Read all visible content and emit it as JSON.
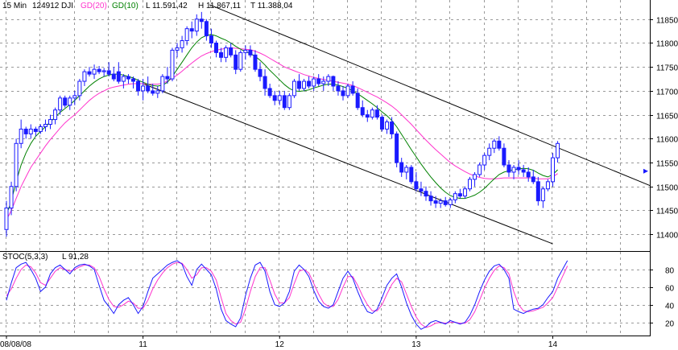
{
  "header": {
    "timeframe": "15 Min",
    "symbol_id": "124912",
    "symbol": "DJI",
    "ma_slow_label": "GD(20)",
    "ma_fast_label": "GD(10)",
    "low_label": "L 11.591,42",
    "high_label": "H 11.867,11",
    "close_label": "T 11.388,04"
  },
  "stoch_header": {
    "indicator_label": "STOC(5,3,3)",
    "last_label": "L 91,28"
  },
  "colors": {
    "up_candle": "#ffffff",
    "down_candle": "#1a1aff",
    "candle_outline": "#1a1aff",
    "ma_slow": "#ff33cc",
    "ma_fast": "#008000",
    "stoch_k": "#1a1aff",
    "stoch_d": "#ff33cc",
    "channel": "#000000",
    "grid": "#9a9a9a",
    "marker": "#1a1aff"
  },
  "chart_data": [
    {
      "type": "candlestick",
      "title": "",
      "y_ticks": [
        11400,
        11450,
        11500,
        11550,
        11600,
        11650,
        11700,
        11750,
        11800,
        11850
      ],
      "ylim": [
        11365,
        11890
      ],
      "x_tick_labels": [
        {
          "bar": 0,
          "label": "08/08/08"
        },
        {
          "bar": 28,
          "label": "11"
        },
        {
          "bar": 56,
          "label": "12"
        },
        {
          "bar": 84,
          "label": "13"
        },
        {
          "bar": 112,
          "label": "14"
        }
      ],
      "grid": true,
      "ohlc": [
        [
          11410,
          11470,
          11395,
          11455
        ],
        [
          11455,
          11510,
          11440,
          11500
        ],
        [
          11500,
          11600,
          11490,
          11590
        ],
        [
          11590,
          11640,
          11580,
          11620
        ],
        [
          11620,
          11625,
          11600,
          11610
        ],
        [
          11610,
          11630,
          11600,
          11620
        ],
        [
          11620,
          11625,
          11605,
          11615
        ],
        [
          11615,
          11630,
          11610,
          11625
        ],
        [
          11625,
          11640,
          11615,
          11630
        ],
        [
          11630,
          11650,
          11620,
          11640
        ],
        [
          11640,
          11665,
          11630,
          11660
        ],
        [
          11660,
          11690,
          11650,
          11685
        ],
        [
          11685,
          11690,
          11665,
          11670
        ],
        [
          11670,
          11690,
          11660,
          11685
        ],
        [
          11685,
          11700,
          11670,
          11690
        ],
        [
          11690,
          11725,
          11680,
          11720
        ],
        [
          11720,
          11745,
          11710,
          11740
        ],
        [
          11740,
          11750,
          11730,
          11735
        ],
        [
          11735,
          11755,
          11725,
          11745
        ],
        [
          11745,
          11752,
          11735,
          11740
        ],
        [
          11740,
          11748,
          11730,
          11742
        ],
        [
          11742,
          11760,
          11730,
          11735
        ],
        [
          11735,
          11750,
          11720,
          11725
        ],
        [
          11740,
          11760,
          11715,
          11720
        ],
        [
          11720,
          11735,
          11705,
          11730
        ],
        [
          11730,
          11735,
          11715,
          11725
        ],
        [
          11725,
          11730,
          11705,
          11720
        ],
        [
          11720,
          11725,
          11690,
          11700
        ],
        [
          11700,
          11725,
          11680,
          11710
        ],
        [
          11710,
          11730,
          11695,
          11700
        ],
        [
          11700,
          11715,
          11690,
          11695
        ],
        [
          11695,
          11710,
          11685,
          11700
        ],
        [
          11700,
          11735,
          11695,
          11730
        ],
        [
          11730,
          11750,
          11715,
          11725
        ],
        [
          11725,
          11790,
          11720,
          11785
        ],
        [
          11785,
          11800,
          11770,
          11790
        ],
        [
          11790,
          11815,
          11780,
          11805
        ],
        [
          11805,
          11835,
          11795,
          11830
        ],
        [
          11830,
          11845,
          11810,
          11825
        ],
        [
          11825,
          11860,
          11815,
          11850
        ],
        [
          11850,
          11865,
          11830,
          11845
        ],
        [
          11845,
          11850,
          11805,
          11815
        ],
        [
          11815,
          11830,
          11790,
          11800
        ],
        [
          11800,
          11805,
          11770,
          11780
        ],
        [
          11780,
          11790,
          11760,
          11770
        ],
        [
          11770,
          11795,
          11760,
          11790
        ],
        [
          11790,
          11800,
          11770,
          11775
        ],
        [
          11775,
          11785,
          11735,
          11745
        ],
        [
          11745,
          11785,
          11740,
          11780
        ],
        [
          11780,
          11795,
          11765,
          11785
        ],
        [
          11785,
          11795,
          11770,
          11775
        ],
        [
          11775,
          11785,
          11740,
          11745
        ],
        [
          11745,
          11760,
          11720,
          11730
        ],
        [
          11730,
          11745,
          11690,
          11705
        ],
        [
          11705,
          11715,
          11685,
          11690
        ],
        [
          11690,
          11700,
          11670,
          11680
        ],
        [
          11680,
          11700,
          11670,
          11690
        ],
        [
          11690,
          11700,
          11660,
          11665
        ],
        [
          11665,
          11695,
          11660,
          11690
        ],
        [
          11690,
          11725,
          11685,
          11720
        ],
        [
          11720,
          11735,
          11700,
          11705
        ],
        [
          11705,
          11725,
          11700,
          11720
        ],
        [
          11720,
          11730,
          11705,
          11710
        ],
        [
          11710,
          11730,
          11700,
          11725
        ],
        [
          11725,
          11735,
          11710,
          11715
        ],
        [
          11715,
          11730,
          11700,
          11720
        ],
        [
          11720,
          11735,
          11710,
          11730
        ],
        [
          11730,
          11732,
          11700,
          11710
        ],
        [
          11710,
          11720,
          11690,
          11700
        ],
        [
          11700,
          11710,
          11680,
          11690
        ],
        [
          11690,
          11715,
          11685,
          11710
        ],
        [
          11710,
          11720,
          11690,
          11695
        ],
        [
          11695,
          11705,
          11660,
          11665
        ],
        [
          11665,
          11680,
          11645,
          11650
        ],
        [
          11650,
          11660,
          11635,
          11645
        ],
        [
          11645,
          11665,
          11640,
          11660
        ],
        [
          11660,
          11670,
          11640,
          11645
        ],
        [
          11645,
          11650,
          11615,
          11620
        ],
        [
          11620,
          11640,
          11610,
          11635
        ],
        [
          11635,
          11645,
          11600,
          11610
        ],
        [
          11610,
          11615,
          11540,
          11550
        ],
        [
          11550,
          11560,
          11520,
          11530
        ],
        [
          11530,
          11545,
          11515,
          11540
        ],
        [
          11540,
          11545,
          11505,
          11510
        ],
        [
          11510,
          11530,
          11490,
          11495
        ],
        [
          11495,
          11510,
          11480,
          11490
        ],
        [
          11490,
          11500,
          11470,
          11480
        ],
        [
          11480,
          11490,
          11460,
          11470
        ],
        [
          11470,
          11480,
          11455,
          11465
        ],
        [
          11465,
          11475,
          11455,
          11470
        ],
        [
          11470,
          11478,
          11458,
          11462
        ],
        [
          11462,
          11476,
          11455,
          11472
        ],
        [
          11472,
          11490,
          11465,
          11485
        ],
        [
          11485,
          11495,
          11475,
          11480
        ],
        [
          11480,
          11500,
          11475,
          11495
        ],
        [
          11495,
          11520,
          11490,
          11515
        ],
        [
          11515,
          11530,
          11500,
          11525
        ],
        [
          11525,
          11550,
          11520,
          11545
        ],
        [
          11545,
          11570,
          11535,
          11565
        ],
        [
          11565,
          11590,
          11555,
          11580
        ],
        [
          11580,
          11600,
          11570,
          11595
        ],
        [
          11595,
          11605,
          11575,
          11580
        ],
        [
          11580,
          11590,
          11540,
          11545
        ],
        [
          11545,
          11555,
          11520,
          11530
        ],
        [
          11530,
          11545,
          11515,
          11540
        ],
        [
          11540,
          11555,
          11525,
          11535
        ],
        [
          11535,
          11545,
          11520,
          11530
        ],
        [
          11530,
          11540,
          11510,
          11520
        ],
        [
          11520,
          11535,
          11505,
          11510
        ],
        [
          11510,
          11520,
          11460,
          11470
        ],
        [
          11470,
          11500,
          11455,
          11495
        ],
        [
          11495,
          11515,
          11490,
          11510
        ],
        [
          11510,
          11570,
          11500,
          11560
        ],
        [
          11560,
          11595,
          11550,
          11590
        ]
      ],
      "ma_slow_values": [
        11430,
        11450,
        11475,
        11500,
        11520,
        11540,
        11555,
        11570,
        11585,
        11598,
        11610,
        11622,
        11633,
        11642,
        11650,
        11660,
        11670,
        11680,
        11688,
        11695,
        11700,
        11705,
        11708,
        11710,
        11712,
        11714,
        11715,
        11715,
        11715,
        11714,
        11714,
        11714,
        11716,
        11720,
        11726,
        11733,
        11741,
        11750,
        11758,
        11766,
        11773,
        11778,
        11782,
        11785,
        11787,
        11789,
        11790,
        11789,
        11788,
        11787,
        11786,
        11783,
        11779,
        11774,
        11768,
        11762,
        11756,
        11750,
        11746,
        11742,
        11738,
        11734,
        11731,
        11728,
        11726,
        11724,
        11722,
        11720,
        11718,
        11716,
        11714,
        11711,
        11707,
        11702,
        11697,
        11692,
        11687,
        11681,
        11675,
        11668,
        11660,
        11650,
        11640,
        11630,
        11619,
        11608,
        11597,
        11587,
        11577,
        11568,
        11559,
        11550,
        11543,
        11537,
        11531,
        11526,
        11522,
        11519,
        11517,
        11516,
        11516,
        11517,
        11518,
        11518,
        11518,
        11518,
        11518,
        11518,
        11518,
        11516,
        11516,
        11516,
        11520,
        11527
      ],
      "ma_fast_values": [
        11440,
        11470,
        11510,
        11545,
        11570,
        11590,
        11605,
        11615,
        11625,
        11635,
        11645,
        11655,
        11663,
        11671,
        11680,
        11690,
        11700,
        11710,
        11718,
        11725,
        11730,
        11733,
        11735,
        11735,
        11733,
        11730,
        11727,
        11722,
        11718,
        11714,
        11711,
        11710,
        11712,
        11718,
        11730,
        11745,
        11760,
        11775,
        11790,
        11802,
        11811,
        11816,
        11818,
        11815,
        11810,
        11806,
        11800,
        11793,
        11787,
        11782,
        11778,
        11772,
        11764,
        11754,
        11743,
        11733,
        11723,
        11713,
        11705,
        11700,
        11699,
        11700,
        11702,
        11706,
        11709,
        11712,
        11714,
        11714,
        11712,
        11709,
        11705,
        11700,
        11694,
        11687,
        11680,
        11673,
        11665,
        11656,
        11648,
        11638,
        11625,
        11609,
        11593,
        11577,
        11562,
        11547,
        11533,
        11520,
        11508,
        11497,
        11488,
        11481,
        11477,
        11475,
        11475,
        11478,
        11482,
        11488,
        11496,
        11506,
        11516,
        11525,
        11530,
        11533,
        11535,
        11537,
        11538,
        11537,
        11534,
        11528,
        11523,
        11520,
        11525,
        11535
      ],
      "marker_price": 11532
    },
    {
      "type": "line",
      "title": "",
      "ylim": [
        5,
        100
      ],
      "y_ticks": [
        20,
        40,
        60,
        80
      ],
      "series": [
        {
          "name": "",
          "values": [
            45,
            65,
            82,
            86,
            88,
            80,
            70,
            55,
            60,
            75,
            82,
            85,
            80,
            75,
            82,
            85,
            86,
            84,
            80,
            62,
            45,
            38,
            30,
            40,
            45,
            48,
            40,
            30,
            38,
            55,
            70,
            75,
            80,
            85,
            88,
            90,
            86,
            72,
            62,
            80,
            86,
            80,
            74,
            58,
            35,
            22,
            18,
            15,
            25,
            50,
            70,
            85,
            88,
            78,
            55,
            40,
            38,
            42,
            55,
            78,
            85,
            80,
            72,
            56,
            44,
            38,
            36,
            40,
            55,
            70,
            78,
            70,
            55,
            42,
            32,
            30,
            35,
            48,
            62,
            70,
            75,
            60,
            42,
            28,
            18,
            12,
            15,
            20,
            22,
            20,
            18,
            22,
            20,
            18,
            20,
            28,
            40,
            55,
            68,
            78,
            84,
            86,
            80,
            70,
            35,
            32,
            30,
            33,
            35,
            36,
            40,
            48,
            55,
            70,
            80,
            90
          ]
        },
        {
          "name": "",
          "values": [
            50,
            58,
            70,
            80,
            85,
            83,
            76,
            65,
            62,
            70,
            78,
            82,
            80,
            78,
            80,
            83,
            85,
            85,
            82,
            72,
            58,
            46,
            38,
            37,
            40,
            44,
            42,
            36,
            36,
            45,
            58,
            68,
            76,
            82,
            86,
            88,
            87,
            80,
            70,
            74,
            82,
            82,
            78,
            68,
            48,
            30,
            22,
            18,
            20,
            35,
            55,
            72,
            82,
            82,
            68,
            52,
            42,
            42,
            48,
            64,
            78,
            80,
            76,
            64,
            52,
            42,
            38,
            38,
            46,
            60,
            72,
            72,
            62,
            50,
            40,
            33,
            33,
            40,
            52,
            63,
            70,
            66,
            52,
            38,
            26,
            18,
            14,
            16,
            19,
            20,
            19,
            20,
            20,
            19,
            19,
            23,
            32,
            45,
            59,
            70,
            79,
            84,
            82,
            75,
            55,
            40,
            33,
            32,
            33,
            35,
            37,
            42,
            48,
            60,
            72,
            84
          ]
        }
      ]
    }
  ]
}
